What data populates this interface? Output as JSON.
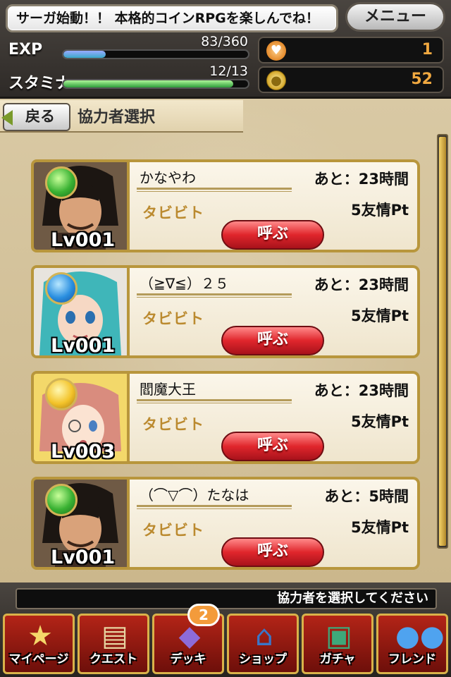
{
  "header": {
    "notice": "サーガ始動！！ 本格的コインRPGを楽しんでね！",
    "menu_label": "メニュー",
    "exp": {
      "label": "EXP",
      "value": "83/360",
      "progress": 0.23
    },
    "stamina": {
      "label": "スタミナ",
      "value": "12/13",
      "progress": 0.92
    },
    "hearts": {
      "icon": "heart-gem-icon",
      "count": "1"
    },
    "coins": {
      "icon": "gold-coin-icon",
      "count": "52"
    }
  },
  "breadcrumb": {
    "back_label": "戻る",
    "title": "協力者選択"
  },
  "helpers": [
    {
      "name": "かなやわ",
      "time": "あと：23時間",
      "skill": "タビビト",
      "points": "5友情Pt",
      "call_label": "呼ぶ",
      "level": "Lv001",
      "orb": "green-orb-icon"
    },
    {
      "name": "（≧∇≦）２５",
      "time": "あと：23時間",
      "skill": "タビビト",
      "points": "5友情Pt",
      "call_label": "呼ぶ",
      "level": "Lv001",
      "orb": "blue-orb-icon"
    },
    {
      "name": "閻魔大王",
      "time": "あと：23時間",
      "skill": "タビビト",
      "points": "5友情Pt",
      "call_label": "呼ぶ",
      "level": "Lv003",
      "orb": "yellow-star-orb-icon"
    },
    {
      "name": "（⌒▽⌒）たなは",
      "time": "あと：5時間",
      "skill": "タビビト",
      "points": "5友情Pt",
      "call_label": "呼ぶ",
      "level": "Lv001",
      "orb": "green-orb-icon"
    }
  ],
  "footer": {
    "status": "協力者を選択してください",
    "nav": [
      {
        "label": "マイページ",
        "icon": "star-icon"
      },
      {
        "label": "クエスト",
        "icon": "map-scroll-icon"
      },
      {
        "label": "デッキ",
        "icon": "cards-icon",
        "badge": "2"
      },
      {
        "label": "ショップ",
        "icon": "house-icon"
      },
      {
        "label": "ガチャ",
        "icon": "treasure-chest-icon"
      },
      {
        "label": "フレンド",
        "icon": "friends-icon"
      }
    ]
  },
  "colors": {
    "accent_red": "#e0262c",
    "gold_border": "#b8963c",
    "skill_text": "#bb8a2f",
    "coin_text": "#f0a840"
  }
}
